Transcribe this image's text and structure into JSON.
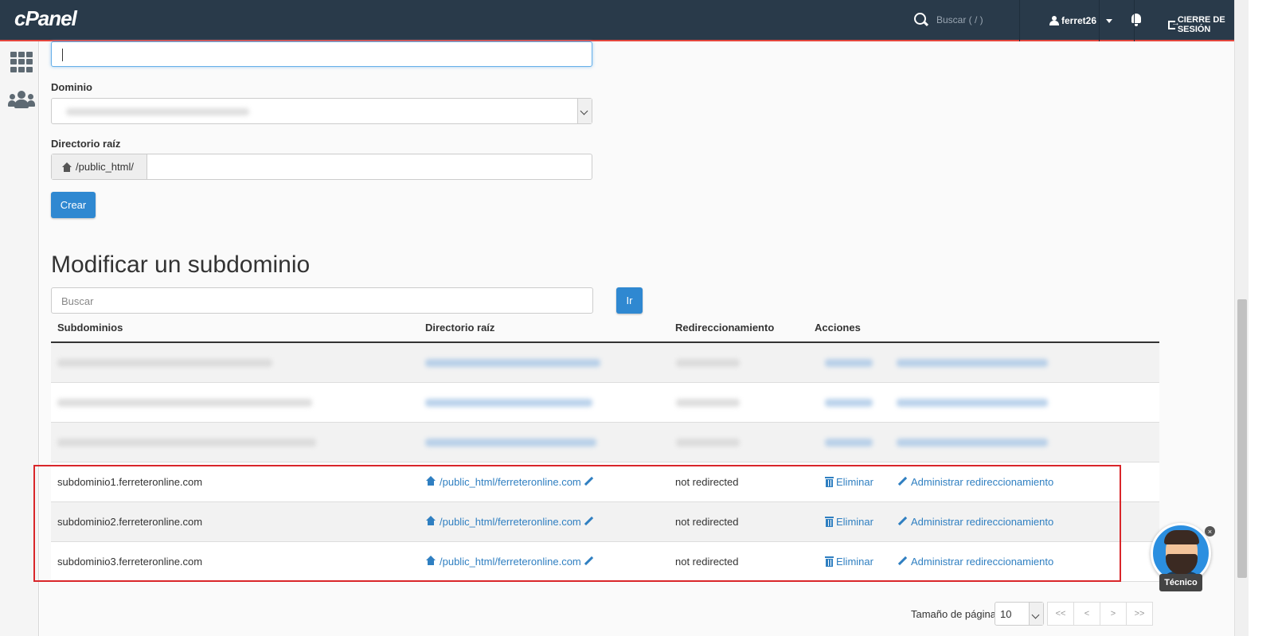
{
  "brand": {
    "logo": "cPanel"
  },
  "topbar": {
    "search_placeholder": "Buscar ( / )",
    "username": "ferret26",
    "logout_label": "CIERRE DE SESIÓN"
  },
  "form": {
    "domain_label": "Dominio",
    "root_dir_label": "Directorio raíz",
    "root_dir_prefix": "/public_html/",
    "create_button": "Crear"
  },
  "modify": {
    "title": "Modificar un subdominio",
    "search_placeholder": "Buscar",
    "go_button": "Ir",
    "columns": [
      "Subdominios",
      "Directorio raíz",
      "Redireccionamiento",
      "Acciones"
    ],
    "rows": [
      {
        "subdomain": "subdominio1.ferreteronline.com",
        "root": "/public_html/ferreteronline.com",
        "redirect": "not redirected",
        "delete": "Eliminar",
        "manage": "Administrar redireccionamiento"
      },
      {
        "subdomain": "subdominio2.ferreteronline.com",
        "root": "/public_html/ferreteronline.com",
        "redirect": "not redirected",
        "delete": "Eliminar",
        "manage": "Administrar redireccionamiento"
      },
      {
        "subdomain": "subdominio3.ferreteronline.com",
        "root": "/public_html/ferreteronline.com",
        "redirect": "not redirected",
        "delete": "Eliminar",
        "manage": "Administrar redireccionamiento"
      }
    ]
  },
  "pagination": {
    "page_size_label": "Tamaño de página",
    "page_size": "10",
    "buttons": [
      "<<",
      "<",
      ">",
      ">>"
    ]
  },
  "chat": {
    "label": "Técnico",
    "close": "×"
  },
  "colors": {
    "navbar": "#293a4a",
    "accent": "#2f88d1",
    "highlight": "#d9262a"
  }
}
